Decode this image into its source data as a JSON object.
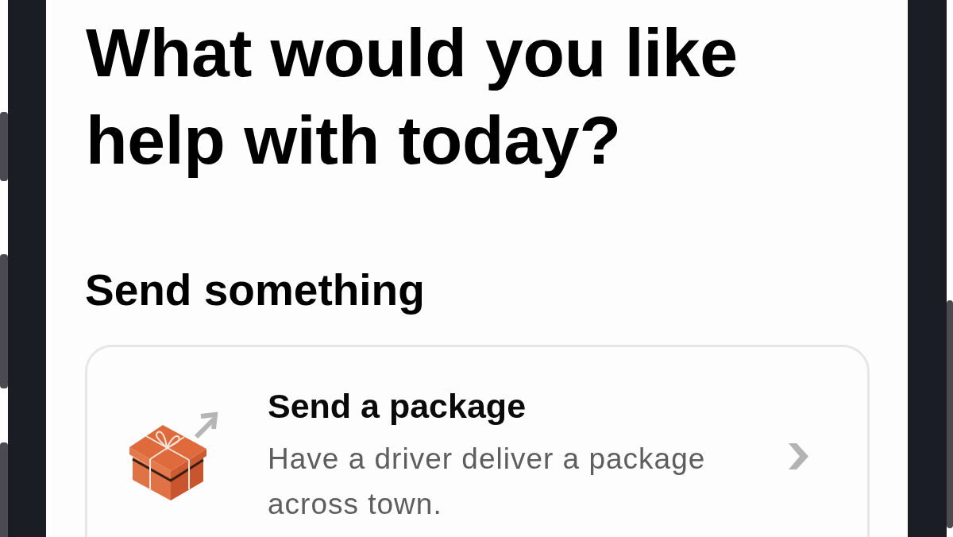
{
  "heading": "What would you like help with today?",
  "section": {
    "title": "Send something",
    "cards": [
      {
        "title": "Send a package",
        "description": "Have a driver deliver a package across town."
      }
    ]
  }
}
